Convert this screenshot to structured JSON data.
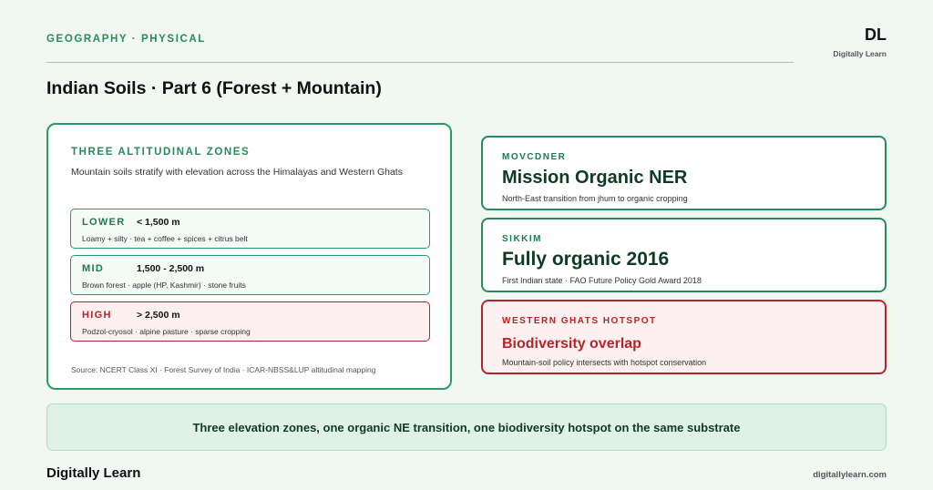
{
  "header": {
    "kicker": "GEOGRAPHY · PHYSICAL",
    "title": "Indian Soils · Part 6 (Forest + Mountain)",
    "logo": {
      "mark": "DL",
      "subtitle": "Digitally Learn"
    }
  },
  "zones_card": {
    "heading": "THREE ALTITUDINAL ZONES",
    "description": "Mountain soils stratify with elevation across the Himalayas and Western Ghats",
    "zones": [
      {
        "name": "LOWER",
        "range": "< 1,500 m",
        "detail": "Loamy + silty · tea + coffee + spices + citrus belt"
      },
      {
        "name": "MID",
        "range": "1,500 - 2,500 m",
        "detail": "Brown forest · apple (HP, Kashmir) · stone fruits"
      },
      {
        "name": "HIGH",
        "range": "> 2,500 m",
        "detail": "Podzol-cryosol · alpine pasture · sparse cropping"
      }
    ],
    "source": "Source: NCERT Class XI · Forest Survey of India · ICAR-NBSS&LUP altitudinal mapping"
  },
  "cards": [
    {
      "tag": "MOVCDNER",
      "headline": "Mission Organic NER",
      "sub": "North-East transition from jhum to organic cropping"
    },
    {
      "tag": "SIKKIM",
      "headline": "Fully organic 2016",
      "sub": "First Indian state · FAO Future Policy Gold Award 2018"
    },
    {
      "tag": "WESTERN GHATS HOTSPOT",
      "headline": "Biodiversity overlap",
      "sub": "Mountain-soil policy intersects with hotspot conservation"
    }
  ],
  "banner": "Three elevation zones, one organic NE transition, one biodiversity hotspot on the same substrate",
  "footer": {
    "brand": "Digitally Learn",
    "url": "digitallylearn.com"
  },
  "colors": {
    "accent": "#2a8a5c",
    "danger": "#b8232a",
    "background": "#f1f7f3"
  }
}
